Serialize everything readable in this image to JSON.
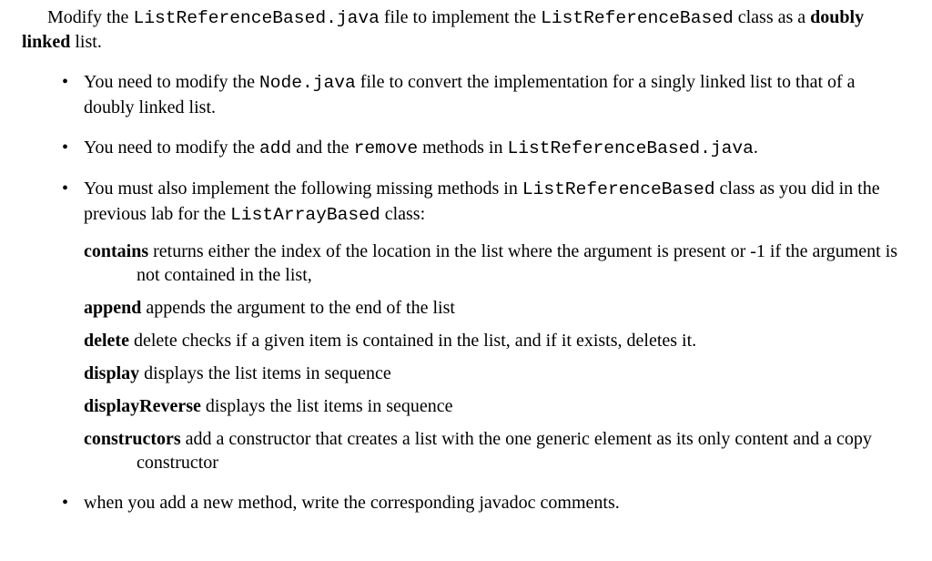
{
  "intro": {
    "pre": "Modify the ",
    "file1": "ListReferenceBased.java",
    "mid1": " file to implement the ",
    "class1": "ListReferenceBased",
    "mid2": " class as a ",
    "bold1": "doubly linked",
    "post": " list."
  },
  "bullets": {
    "b1": {
      "pre": "You need to modify the ",
      "file": "Node.java",
      "post": " file to convert the implementation for a singly linked list to that of a doubly linked list."
    },
    "b2": {
      "pre": "You need to modify the ",
      "m1": "add",
      "mid1": " and the ",
      "m2": "remove",
      "mid2": " methods in ",
      "file": "ListReferenceBased.java",
      "post": "."
    },
    "b3": {
      "pre": "You must also implement the following missing methods in ",
      "c1": "ListReferenceBased",
      "mid": " class as you did in the previous lab for the ",
      "c2": "ListArrayBased",
      "post": " class:"
    },
    "b4": "when you add a new method, write the corresponding javadoc comments."
  },
  "methods": {
    "contains": {
      "name": "contains",
      "desc": " returns either the index of the location in the list where the argument is present or -1 if the argument is not contained in the list,"
    },
    "append": {
      "name": "append",
      "desc": " appends the argument to the end of the list"
    },
    "delete": {
      "name": "delete",
      "desc": " delete checks if a given item is contained in the list, and if it exists, deletes it."
    },
    "display": {
      "name": "display",
      "desc": " displays the list items in sequence"
    },
    "displayReverse": {
      "name": "displayReverse",
      "desc": " displays the list items in sequence"
    },
    "constructors": {
      "name": "constructors",
      "desc": " add a constructor that creates a list with the one generic element as its only content and a copy constructor"
    }
  }
}
